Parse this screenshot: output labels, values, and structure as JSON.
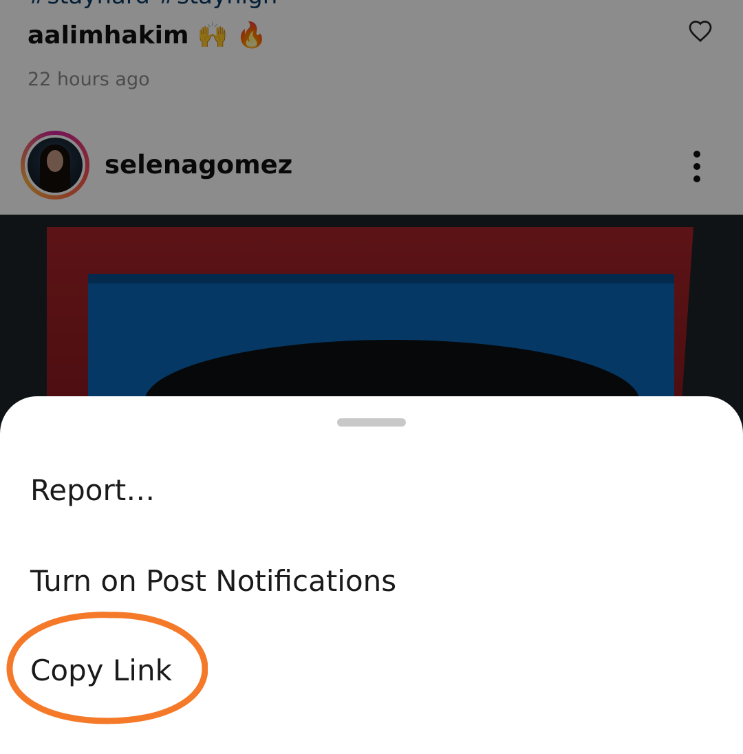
{
  "comment": {
    "hashtags": "#stayhard #stayhigh",
    "username": "aalimhakim",
    "emojis": [
      "🙌",
      "🔥"
    ],
    "timestamp": "22 hours ago",
    "like_icon": "heart-outline-icon"
  },
  "post": {
    "username": "selenagomez",
    "avatar_ring_colors": [
      "#d6249f",
      "#fd5949",
      "#fdb041"
    ],
    "more_icon": "vertical-ellipsis-icon"
  },
  "sheet": {
    "items": [
      {
        "label": "Report…"
      },
      {
        "label": "Turn on Post Notifications"
      },
      {
        "label": "Copy Link"
      }
    ]
  },
  "annotation": {
    "color": "#f47a2a",
    "target": "Copy Link"
  }
}
